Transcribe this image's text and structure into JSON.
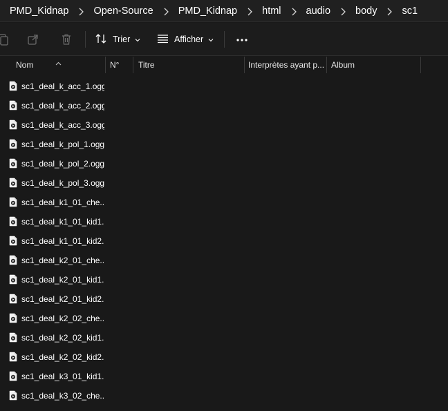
{
  "breadcrumb": [
    "PMD_Kidnap",
    "Open-Source",
    "PMD_Kidnap",
    "html",
    "audio",
    "body",
    "sc1"
  ],
  "toolbar": {
    "sort_label": "Trier",
    "view_label": "Afficher",
    "more_label": "•••"
  },
  "columns": {
    "name": "Nom",
    "number": "N°",
    "title": "Titre",
    "artists": "Interprètes ayant p...",
    "album": "Album"
  },
  "files": [
    "sc1_deal_k_acc_1.ogg",
    "sc1_deal_k_acc_2.ogg",
    "sc1_deal_k_acc_3.ogg",
    "sc1_deal_k_pol_1.ogg",
    "sc1_deal_k_pol_2.ogg",
    "sc1_deal_k_pol_3.ogg",
    "sc1_deal_k1_01_che...",
    "sc1_deal_k1_01_kid1...",
    "sc1_deal_k1_01_kid2...",
    "sc1_deal_k2_01_che...",
    "sc1_deal_k2_01_kid1...",
    "sc1_deal_k2_01_kid2...",
    "sc1_deal_k2_02_che...",
    "sc1_deal_k2_02_kid1...",
    "sc1_deal_k2_02_kid2...",
    "sc1_deal_k3_01_kid1...",
    "sc1_deal_k3_02_che..."
  ],
  "icons": {
    "toolbar": [
      "copy-icon",
      "share-icon",
      "delete-icon",
      "sort-icon",
      "view-icon",
      "more-icon"
    ],
    "file": "audio-file-icon"
  },
  "colors": {
    "background": "#191919",
    "breadcrumb_bg": "#202020",
    "text": "#ffffff",
    "divider": "#3a3a3a"
  }
}
